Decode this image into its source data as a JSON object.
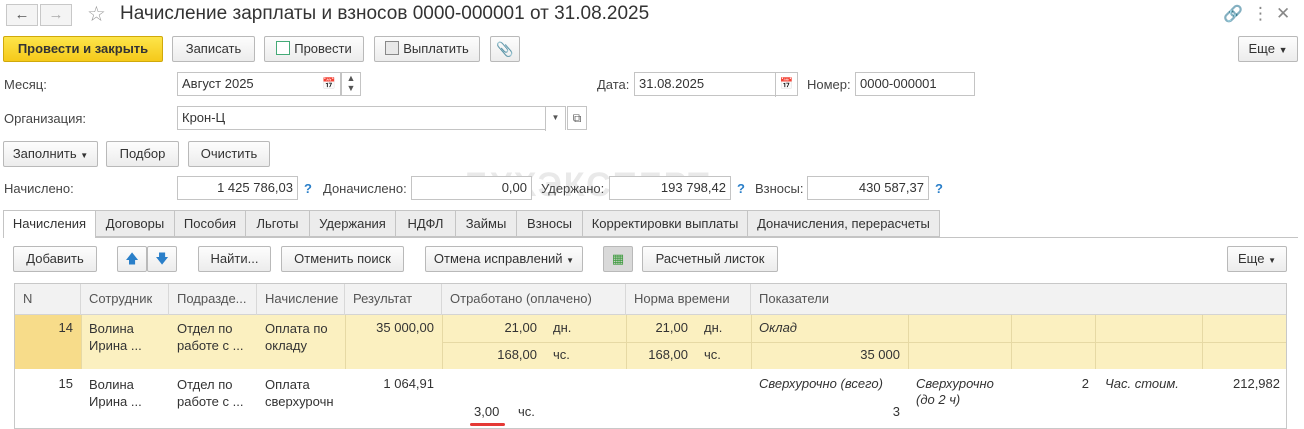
{
  "window": {
    "title": "Начисление зарплаты и взносов 0000-000001 от 31.08.2025"
  },
  "toolbar": {
    "post_close": "Провести и закрыть",
    "save": "Записать",
    "post": "Провести",
    "pay": "Выплатить",
    "more": "Еще"
  },
  "form": {
    "month_label": "Месяц:",
    "month_value": "Август 2025",
    "date_label": "Дата:",
    "date_value": "31.08.2025",
    "number_label": "Номер:",
    "number_value": "0000-000001",
    "org_label": "Организация:",
    "org_value": "Крон-Ц"
  },
  "actions": {
    "fill": "Заполнить",
    "select": "Подбор",
    "clear": "Очистить"
  },
  "totals": {
    "accrued_label": "Начислено:",
    "accrued_value": "1 425 786,03",
    "additional_label": "Доначислено:",
    "additional_value": "0,00",
    "withheld_label": "Удержано:",
    "withheld_value": "193 798,42",
    "contrib_label": "Взносы:",
    "contrib_value": "430 587,37",
    "help": "?"
  },
  "tabs": [
    "Начисления",
    "Договоры",
    "Пособия",
    "Льготы",
    "Удержания",
    "НДФЛ",
    "Займы",
    "Взносы",
    "Корректировки выплаты",
    "Доначисления, перерасчеты"
  ],
  "tab_toolbar": {
    "add": "Добавить",
    "find": "Найти...",
    "cancel_search": "Отменить поиск",
    "cancel_fixes": "Отмена исправлений",
    "payslip": "Расчетный листок",
    "more": "Еще"
  },
  "table": {
    "columns": [
      "N",
      "Сотрудник",
      "Подразде...",
      "Начисление",
      "Результат",
      "Отработано (оплачено)",
      "Норма времени",
      "Показатели"
    ],
    "rows": [
      {
        "n": "14",
        "employee": "Волина Ирина ...",
        "dept": "Отдел по работе с ...",
        "accrual": "Оплата по окладу",
        "result": "35 000,00",
        "worked_days": "21,00",
        "worked_days_unit": "дн.",
        "worked_hours": "168,00",
        "worked_hours_unit": "чс.",
        "norm_days": "21,00",
        "norm_days_unit": "дн.",
        "norm_hours": "168,00",
        "norm_hours_unit": "чс.",
        "ind_name": "Оклад",
        "ind_value": "35 000"
      },
      {
        "n": "15",
        "employee": "Волина Ирина ...",
        "dept": "Отдел по работе с ...",
        "accrual": "Оплата сверхурочн",
        "result": "1 064,91",
        "worked_hours": "3,00",
        "worked_hours_unit": "чс.",
        "ind1_name": "Сверхурочно (всего)",
        "ind1_value": "3",
        "ind2_name": "Сверхурочно (до 2 ч)",
        "ind2_value": "2",
        "ind3_name": "Час. стоим.",
        "ind3_value": "212,982"
      }
    ]
  },
  "watermark": "БУХЭКСПЕРТ",
  "colors": {
    "primary_button": "#f5c91a",
    "selected_row": "#fbf0c0",
    "help_icon": "#2a7fc9",
    "highlight_underline": "#e53935"
  }
}
